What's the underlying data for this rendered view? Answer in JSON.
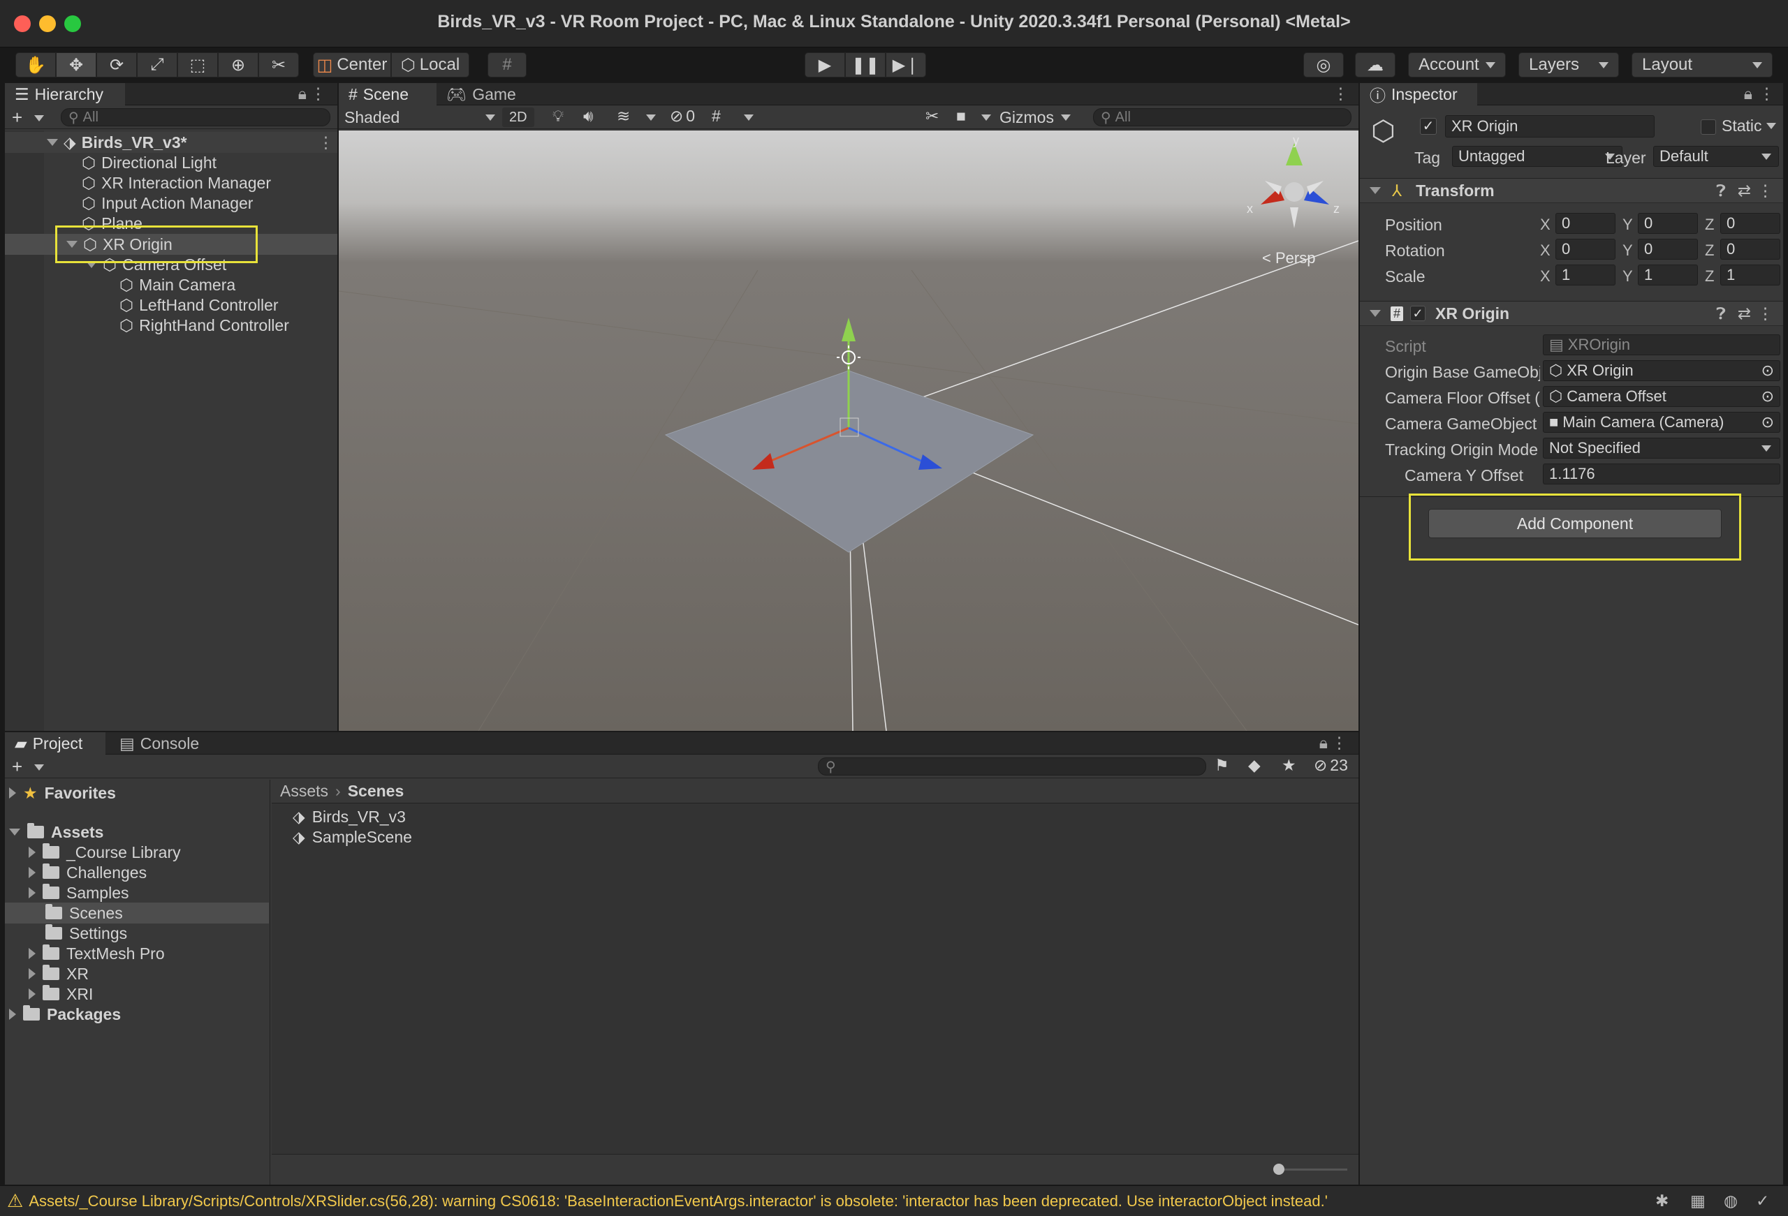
{
  "window": {
    "title": "Birds_VR_v3 - VR Room Project - PC, Mac & Linux Standalone - Unity 2020.3.34f1 Personal (Personal) <Metal>"
  },
  "toolbar": {
    "pivot_label": "Center",
    "space_label": "Local",
    "account_label": "Account",
    "layers_label": "Layers",
    "layout_label": "Layout"
  },
  "hierarchy": {
    "tab_label": "Hierarchy",
    "search_placeholder": "All",
    "scene_name": "Birds_VR_v3*",
    "items": [
      {
        "label": "Directional Light"
      },
      {
        "label": "XR Interaction Manager"
      },
      {
        "label": "Input Action Manager"
      },
      {
        "label": "Plane"
      },
      {
        "label": "XR Origin"
      },
      {
        "label": "Camera Offset"
      },
      {
        "label": "Main Camera"
      },
      {
        "label": "LeftHand Controller"
      },
      {
        "label": "RightHand Controller"
      }
    ]
  },
  "scene_view": {
    "tabs": [
      {
        "label": "Scene"
      },
      {
        "label": "Game"
      }
    ],
    "draw_mode": "Shaded",
    "mode_2d": "2D",
    "hidden_count": "0",
    "gizmos_label": "Gizmos",
    "search_placeholder": "All",
    "projection_label": "< Persp",
    "axis_x": "x",
    "axis_y": "y",
    "axis_z": "z"
  },
  "inspector": {
    "tab_label": "Inspector",
    "object_name": "XR Origin",
    "static_label": "Static",
    "tag_label": "Tag",
    "tag_value": "Untagged",
    "layer_label": "Layer",
    "layer_value": "Default",
    "transform": {
      "title": "Transform",
      "position_label": "Position",
      "rotation_label": "Rotation",
      "scale_label": "Scale",
      "position": [
        "0",
        "0",
        "0"
      ],
      "rotation": [
        "0",
        "0",
        "0"
      ],
      "scale": [
        "1",
        "1",
        "1"
      ]
    },
    "xr_origin": {
      "title": "XR Origin",
      "script_label": "Script",
      "script_value": "XROrigin",
      "origin_base_label": "Origin Base GameObj",
      "origin_base_value": "XR Origin",
      "camera_floor_label": "Camera Floor Offset (",
      "camera_floor_value": "Camera Offset",
      "camera_go_label": "Camera GameObject",
      "camera_go_value": "Main Camera (Camera)",
      "tracking_label": "Tracking Origin Mode",
      "tracking_value": "Not Specified",
      "camera_y_label": "Camera Y Offset",
      "camera_y_value": "1.1176"
    },
    "add_component_label": "Add Component"
  },
  "project": {
    "tabs": [
      {
        "label": "Project"
      },
      {
        "label": "Console"
      }
    ],
    "hidden_count": "23",
    "favorites_label": "Favorites",
    "assets_label": "Assets",
    "folders": [
      {
        "label": "_Course Library"
      },
      {
        "label": "Challenges"
      },
      {
        "label": "Samples"
      },
      {
        "label": "Scenes"
      },
      {
        "label": "Settings"
      },
      {
        "label": "TextMesh Pro"
      },
      {
        "label": "XR"
      },
      {
        "label": "XRI"
      }
    ],
    "packages_label": "Packages",
    "breadcrumb_root": "Assets",
    "breadcrumb_current": "Scenes",
    "files": [
      {
        "label": "Birds_VR_v3"
      },
      {
        "label": "SampleScene"
      }
    ]
  },
  "status": {
    "message": "Assets/_Course Library/Scripts/Controls/XRSlider.cs(56,28): warning CS0618: 'BaseInteractionEventArgs.interactor' is obsolete: 'interactor has been deprecated. Use interactorObject instead.'"
  },
  "colors": {
    "highlight": "#e8e23a",
    "selection": "#4d4d4d",
    "warning": "#f2c94c"
  }
}
